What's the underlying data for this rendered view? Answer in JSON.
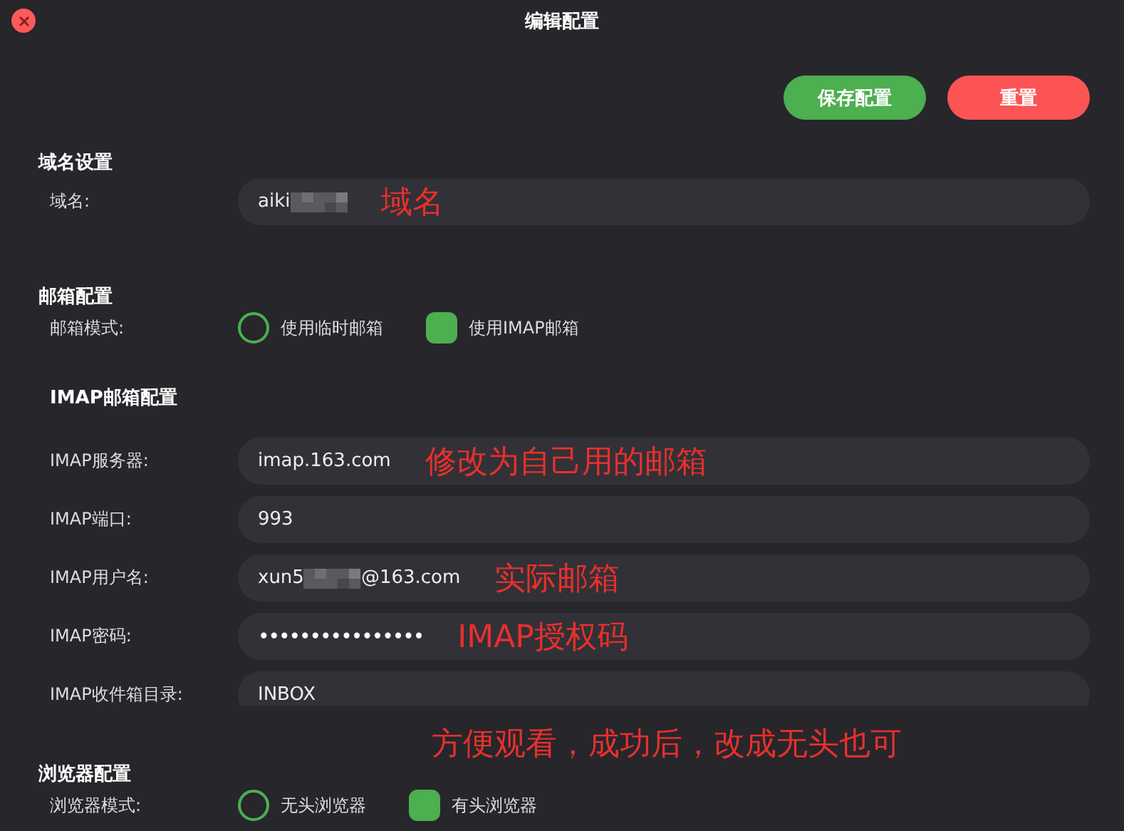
{
  "window": {
    "title": "编辑配置"
  },
  "buttons": [
    {
      "label": "保存配置",
      "kind": "save"
    },
    {
      "label": "重置",
      "kind": "reset"
    }
  ],
  "sections": [
    {
      "kind": "fields",
      "title": "域名设置",
      "fields": [
        {
          "label": "域名:",
          "value": [
            {
              "kind": "text",
              "text": "aiki"
            },
            {
              "kind": "redacted"
            }
          ],
          "annotation": "域名"
        }
      ]
    },
    {
      "kind": "radios",
      "title": "邮箱配置",
      "label": "邮箱模式:",
      "options": [
        {
          "label": "使用临时邮箱",
          "selected": false
        },
        {
          "label": "使用IMAP邮箱",
          "selected": true
        }
      ]
    },
    {
      "kind": "subfields",
      "title": "IMAP邮箱配置",
      "fields": [
        {
          "label": "IMAP服务器:",
          "value": [
            {
              "kind": "text",
              "text": "imap.163.com"
            }
          ],
          "annotation": "修改为自己用的邮箱"
        },
        {
          "label": "IMAP端口:",
          "value": [
            {
              "kind": "text",
              "text": "993"
            }
          ]
        },
        {
          "label": "IMAP用户名:",
          "value": [
            {
              "kind": "text",
              "text": "xun5"
            },
            {
              "kind": "redacted"
            },
            {
              "kind": "text",
              "text": "@163.com"
            }
          ],
          "annotation": "实际邮箱"
        },
        {
          "label": "IMAP密码:",
          "value": [
            {
              "kind": "dots",
              "text": "••••••••••••••••"
            }
          ],
          "annotation": "IMAP授权码"
        },
        {
          "label": "IMAP收件箱目录:",
          "value": [
            {
              "kind": "text",
              "text": "INBOX"
            }
          ]
        }
      ]
    },
    {
      "kind": "radios",
      "title": "浏览器配置",
      "annotation": "方便观看，成功后，改成无头也可",
      "label": "浏览器模式:",
      "options": [
        {
          "label": "无头浏览器",
          "selected": false
        },
        {
          "label": "有头浏览器",
          "selected": true
        }
      ]
    }
  ]
}
